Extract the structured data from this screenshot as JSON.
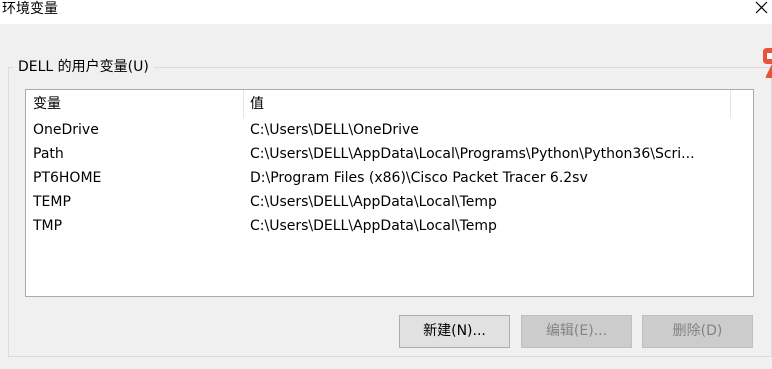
{
  "window": {
    "title": "环境变量"
  },
  "user_vars": {
    "group_label": "DELL 的用户变量(U)",
    "columns": [
      "变量",
      "值"
    ],
    "rows": [
      {
        "name": "OneDrive",
        "value": "C:\\Users\\DELL\\OneDrive"
      },
      {
        "name": "Path",
        "value": "C:\\Users\\DELL\\AppData\\Local\\Programs\\Python\\Python36\\Scri..."
      },
      {
        "name": "PT6HOME",
        "value": "D:\\Program Files (x86)\\Cisco Packet Tracer 6.2sv"
      },
      {
        "name": "TEMP",
        "value": "C:\\Users\\DELL\\AppData\\Local\\Temp"
      },
      {
        "name": "TMP",
        "value": "C:\\Users\\DELL\\AppData\\Local\\Temp"
      }
    ],
    "buttons": {
      "new_label": "新建(N)...",
      "edit_label": "编辑(E)...",
      "delete_label": "删除(D)"
    }
  },
  "icons": {
    "close": "close-icon",
    "side_mark": "edge-badge-icon"
  },
  "colors": {
    "background": "#f0f0f0",
    "list_background": "#ffffff",
    "side_mark": "#e8533a",
    "disabled_text": "#838383"
  }
}
